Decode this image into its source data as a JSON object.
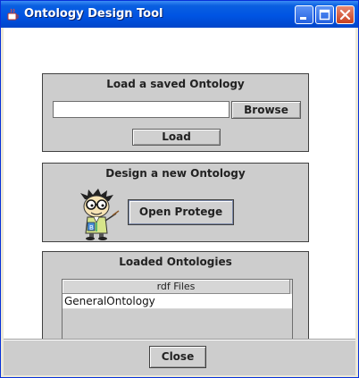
{
  "window": {
    "title": "Ontology Design Tool"
  },
  "title_buttons": {
    "minimize": "minimize-icon",
    "maximize": "maximize-icon",
    "close": "close-icon"
  },
  "load_panel": {
    "title": "Load a saved Ontology",
    "path_value": "",
    "browse_label": "Browse",
    "load_label": "Load"
  },
  "design_panel": {
    "title": "Design a new Ontology",
    "mascot_icon": "professor-mascot-icon",
    "open_label": "Open Protege"
  },
  "loaded_panel": {
    "title": "Loaded Ontologies",
    "table": {
      "column_header": "rdf Files",
      "rows": [
        "GeneralOntology"
      ]
    }
  },
  "footer": {
    "close_label": "Close"
  },
  "colors": {
    "titlebar": "#0054e3",
    "panel": "#cdcdcd",
    "window_bg": "#ffffff"
  }
}
